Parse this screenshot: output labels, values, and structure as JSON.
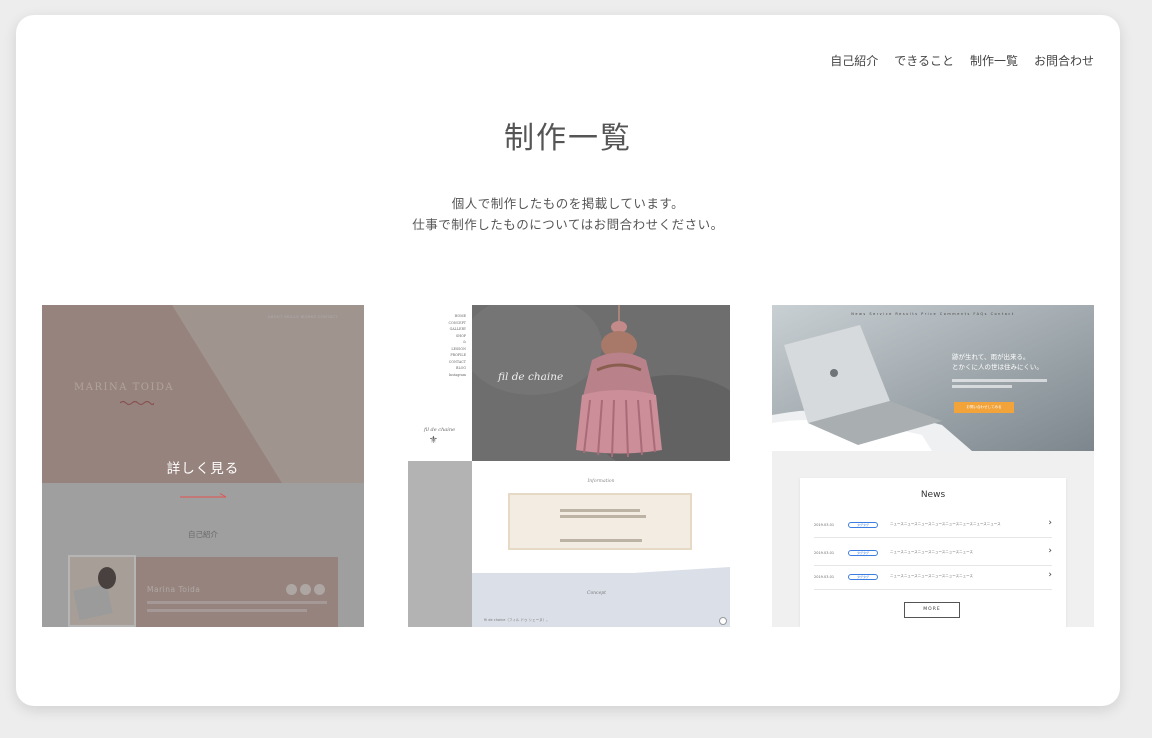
{
  "nav": {
    "items": [
      "自己紹介",
      "できること",
      "制作一覧",
      "お問合わせ"
    ]
  },
  "page": {
    "title": "制作一覧",
    "lead_line1": "個人で制作したものを掲載しています。",
    "lead_line2": "仕事で制作したものについてはお問合わせください。"
  },
  "works": [
    {
      "nav": "ABOUT   SKILLS   WORKS   CONTACT",
      "logo": "MARINA TOIDA",
      "hover_label": "詳しく見る",
      "section_label": "自己紹介",
      "profile_name": "Marina Toida",
      "colors": {
        "hero": "#c9a59a"
      }
    },
    {
      "menu": [
        "HOME",
        "CONCEPT",
        "GALLERY",
        "SHOP",
        "&",
        "LESSON",
        "PROFILE",
        "CONTACT",
        "BLOG",
        "Instagram"
      ],
      "hero_title": "fil de chaine",
      "side_logo": "fil de chaine",
      "info_heading": "Information",
      "concept_heading": "Concept",
      "concept_text": "fil de chaine（フィル ドゥ シェーヌ）。"
    },
    {
      "nav": "News   Service   Results   Price   Comments   FAQs   Contact",
      "headline_line1": "跡が生れて、雨が出来る。",
      "headline_line2": "とかくに人の世は住みにくい。",
      "cta": "お問い合わせしてみる",
      "news_title": "News",
      "news": [
        {
          "date": "2019.03.01",
          "tag": "タグタグ",
          "text": "ニュースニュースニュースニュースニュースニュースニュースニュース"
        },
        {
          "date": "2019.03.01",
          "tag": "タグタグ",
          "text": "ニュースニュースニュースニュースニュースニュース"
        },
        {
          "date": "2019.03.01",
          "tag": "タグタグ",
          "text": "ニュースニュースニュースニュースニュースニュース"
        }
      ],
      "more": "MORE"
    }
  ]
}
